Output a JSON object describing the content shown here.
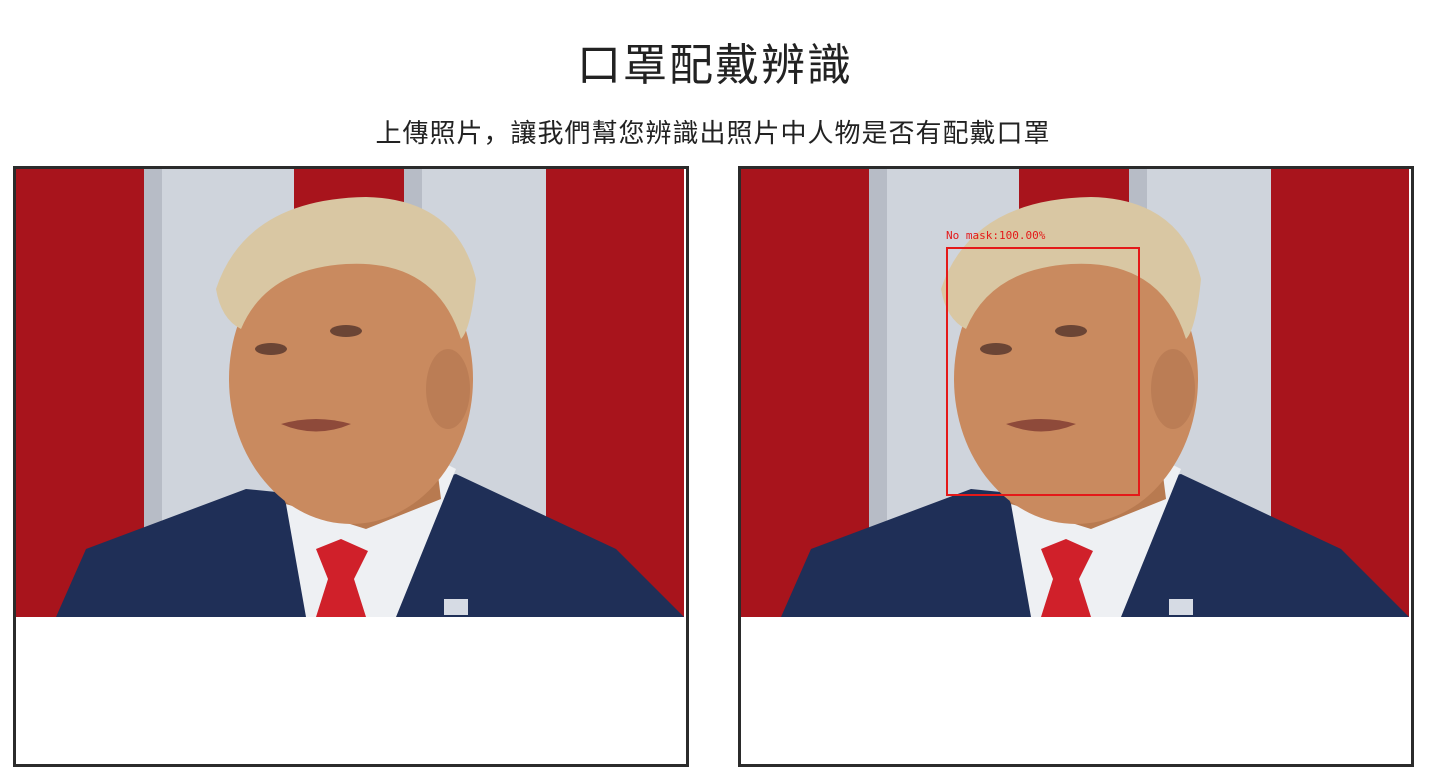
{
  "page": {
    "title": "口罩配戴辨識",
    "subtitle": "上傳照片，讓我們幫您辨識出照片中人物是否有配戴口罩"
  },
  "panels": {
    "original": {
      "image_alt": "uploaded-photo"
    },
    "result": {
      "image_alt": "detection-result-photo",
      "detection": {
        "label": "No mask:100.00%",
        "box_color": "#e41919"
      }
    }
  },
  "colors": {
    "flag_red": "#a8141c",
    "flag_white": "#cfd4dc",
    "suit_blue": "#1f2f57",
    "tie_red": "#d0202a",
    "skin": "#c98a5f",
    "hair": "#d9c7a3",
    "border": "#2b2b2b"
  }
}
